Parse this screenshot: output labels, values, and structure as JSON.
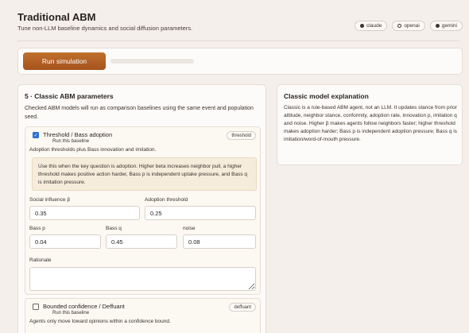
{
  "header": {
    "title": "Traditional ABM",
    "subtitle": "Tune non-LLM baseline dynamics and social diffusion parameters."
  },
  "providers": [
    {
      "label": "claude",
      "icon": "filled-dot-icon",
      "selected": true
    },
    {
      "label": "openai",
      "icon": "hollow-dot-icon",
      "selected": false
    },
    {
      "label": "gemini",
      "icon": "filled-dot-icon",
      "selected": true
    }
  ],
  "run": {
    "button_label": "Run simulation",
    "progress": 0
  },
  "params": {
    "title": "5 · Classic ABM parameters",
    "description": "Checked ABM models will run as comparison baselines using the same event and population seed."
  },
  "models": [
    {
      "name": "Threshold / Bass adoption",
      "run_label": "Run this baseline",
      "tag": "threshold",
      "checked": true,
      "description": "Adoption thresholds plus Bass innovation and imitation.",
      "hint": "Use this when the key question is adoption. Higher beta increases neighbor pull, a higher threshold makes positive action harder, Bass p is independent uptake pressure, and Bass q is imitation pressure.",
      "fields": {
        "social_influence": {
          "label": "Social influence β",
          "value": "0.35"
        },
        "adoption_threshold": {
          "label": "Adoption threshold",
          "value": "0.25"
        },
        "bass_p": {
          "label": "Bass p",
          "value": "0.04"
        },
        "bass_q": {
          "label": "Bass q",
          "value": "0.45"
        },
        "noise": {
          "label": "noise",
          "value": "0.08"
        },
        "rationale": {
          "label": "Rationale",
          "value": ""
        }
      }
    },
    {
      "name": "Bounded confidence / Deffuant",
      "run_label": "Run this baseline",
      "tag": "deffuant",
      "checked": false,
      "description": "Agents only move toward opinions within a confidence bound."
    }
  ],
  "explanation": {
    "title": "Classic model explanation",
    "text": "Classic is a rule-based ABM agent, not an LLM. It updates stance from prior attitude, neighbor stance, conformity, adoption rate, innovation p, imitation q and noise. Higher β makes agents follow neighbors faster; higher threshold makes adoption harder; Bass p is independent adoption pressure; Bass q is imitation/word-of-mouth pressure."
  }
}
